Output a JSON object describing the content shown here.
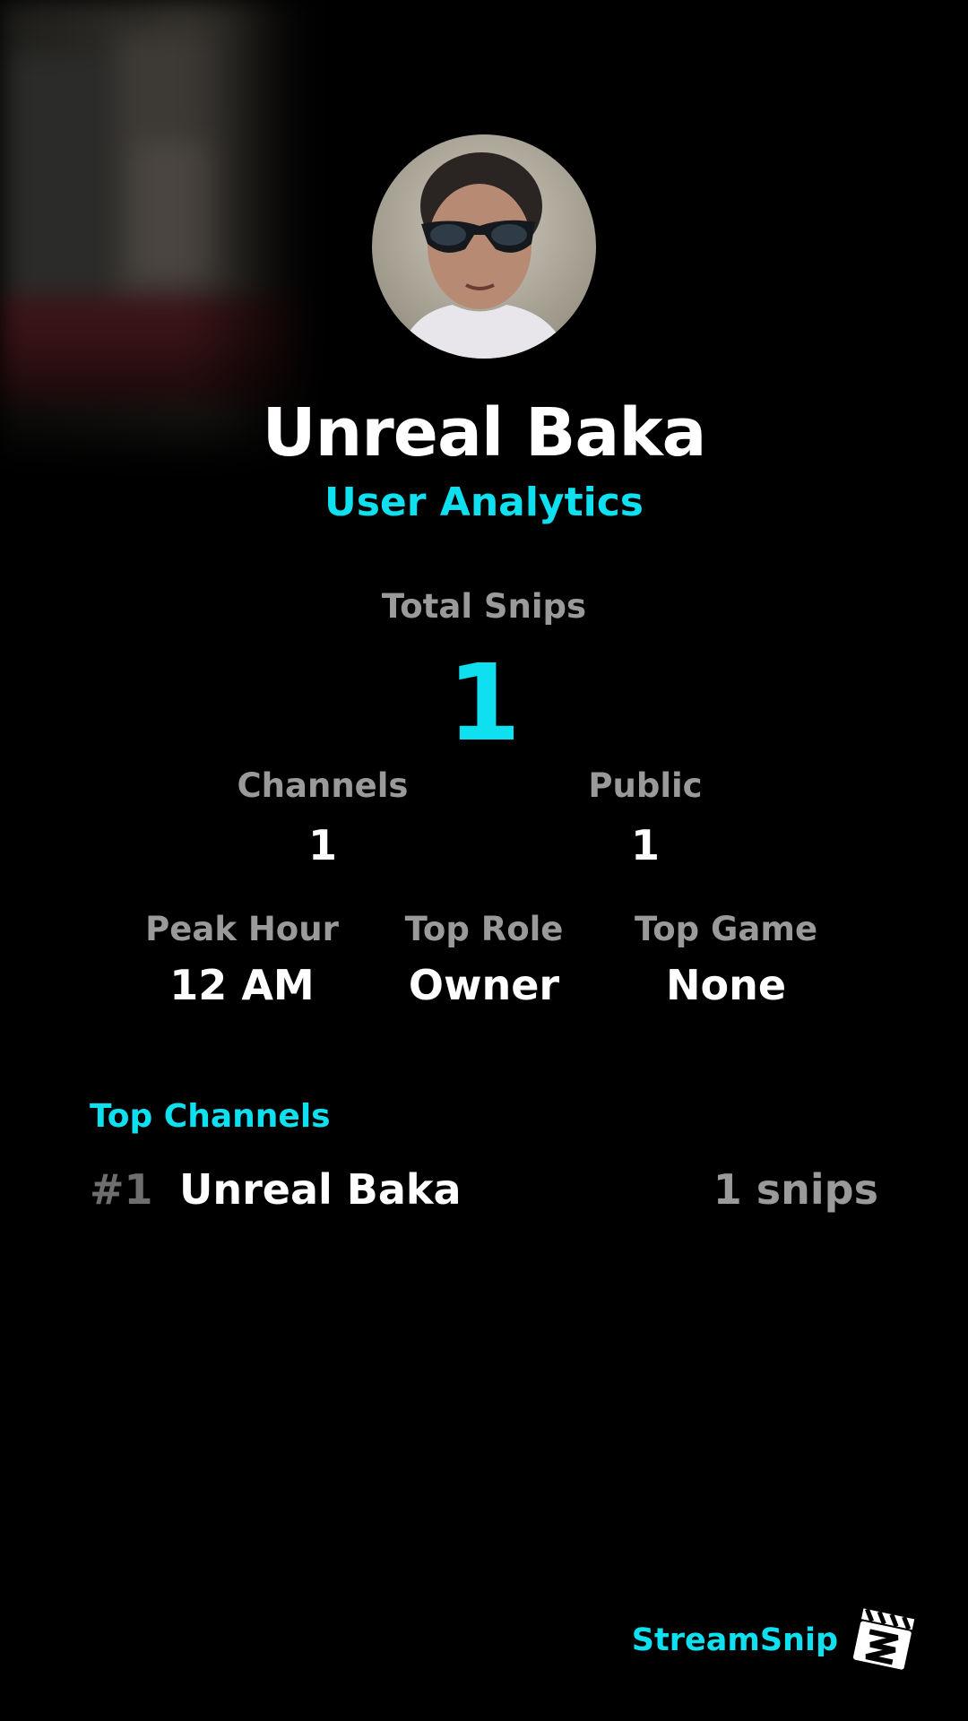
{
  "profile": {
    "name": "Unreal Baka",
    "subtitle": "User Analytics"
  },
  "total": {
    "label": "Total Snips",
    "value": "1"
  },
  "stats_row1": [
    {
      "label": "Channels",
      "value": "1"
    },
    {
      "label": "Public",
      "value": "1"
    }
  ],
  "stats_row2": [
    {
      "label": "Peak Hour",
      "value": "12 AM"
    },
    {
      "label": "Top Role",
      "value": "Owner"
    },
    {
      "label": "Top Game",
      "value": "None"
    }
  ],
  "top_channels": {
    "title": "Top Channels",
    "items": [
      {
        "rank": "#1",
        "name": "Unreal Baka",
        "count": "1 snips"
      }
    ]
  },
  "brand": {
    "name": "StreamSnip",
    "logo_icon": "clapperboard-icon"
  },
  "colors": {
    "accent": "#0fe0f0",
    "background": "#000000",
    "muted": "#9a9a9a"
  }
}
